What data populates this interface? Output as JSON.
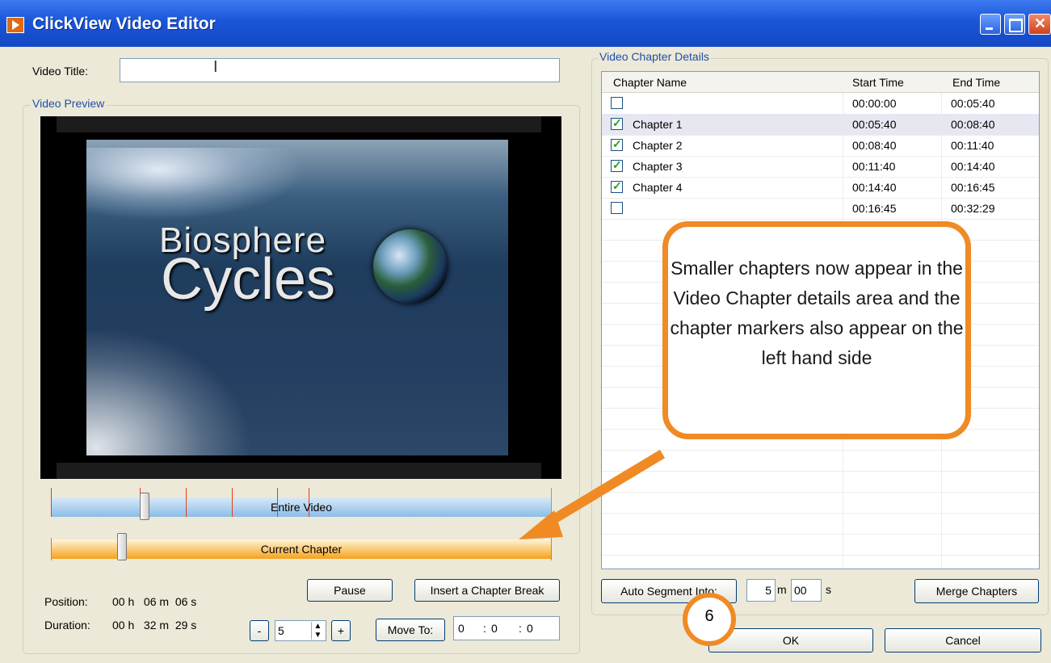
{
  "window": {
    "title": "ClickView Video Editor"
  },
  "video_title": {
    "label": "Video Title:",
    "value": ""
  },
  "preview": {
    "group_label": "Video Preview",
    "frame_line1": "Biosphere",
    "frame_line2": "Cycles",
    "entire_label": "Entire Video",
    "chapter_label": "Current Chapter"
  },
  "position": {
    "label": "Position:",
    "value": "00 h   06 m  06 s"
  },
  "duration": {
    "label": "Duration:",
    "value": "00 h   32 m  29 s"
  },
  "controls": {
    "pause": "Pause",
    "insert_break": "Insert a Chapter Break",
    "minus": "-",
    "plus": "+",
    "step_value": "5",
    "move_to": "Move To:",
    "move_h": "0",
    "move_m": "0",
    "move_s": "0"
  },
  "chapters": {
    "group_label": "Video Chapter Details",
    "columns": [
      "Chapter Name",
      "Start Time",
      "End Time"
    ],
    "rows": [
      {
        "name": "",
        "checked": false,
        "start": "00:00:00",
        "end": "00:05:40"
      },
      {
        "name": "Chapter 1",
        "checked": true,
        "start": "00:05:40",
        "end": "00:08:40"
      },
      {
        "name": "Chapter 2",
        "checked": true,
        "start": "00:08:40",
        "end": "00:11:40"
      },
      {
        "name": "Chapter 3",
        "checked": true,
        "start": "00:11:40",
        "end": "00:14:40"
      },
      {
        "name": "Chapter 4",
        "checked": true,
        "start": "00:14:40",
        "end": "00:16:45"
      },
      {
        "name": "",
        "checked": false,
        "start": "00:16:45",
        "end": "00:32:29"
      }
    ]
  },
  "segment": {
    "auto_segment": "Auto Segment Into:",
    "minutes": "5",
    "m_unit": "m",
    "seconds": "00",
    "s_unit": "s",
    "merge": "Merge Chapters"
  },
  "dialog": {
    "ok": "OK",
    "cancel": "Cancel"
  },
  "annotation": {
    "callout_text": "Smaller chapters now appear in the Video Chapter details area and the chapter markers also appear on the left hand side",
    "step_number": "6",
    "accent_color": "#f08a24"
  }
}
